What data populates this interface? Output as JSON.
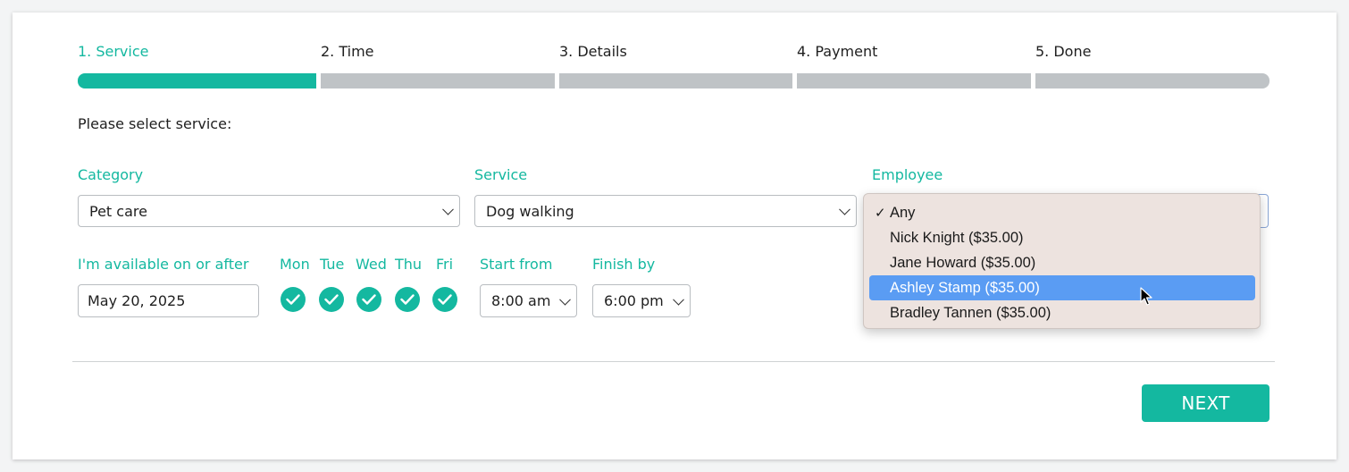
{
  "steps": [
    {
      "label": "1. Service",
      "active": true
    },
    {
      "label": "2. Time",
      "active": false
    },
    {
      "label": "3. Details",
      "active": false
    },
    {
      "label": "4. Payment",
      "active": false
    },
    {
      "label": "5. Done",
      "active": false
    }
  ],
  "prompt": "Please select service:",
  "category": {
    "label": "Category",
    "value": "Pet care"
  },
  "service": {
    "label": "Service",
    "value": "Dog walking"
  },
  "employee": {
    "label": "Employee",
    "options": [
      {
        "label": "Any",
        "checked": true,
        "highlighted": false
      },
      {
        "label": "Nick Knight ($35.00)",
        "checked": false,
        "highlighted": false
      },
      {
        "label": "Jane Howard ($35.00)",
        "checked": false,
        "highlighted": false
      },
      {
        "label": "Ashley Stamp ($35.00)",
        "checked": false,
        "highlighted": true
      },
      {
        "label": "Bradley Tannen ($35.00)",
        "checked": false,
        "highlighted": false
      }
    ]
  },
  "availability": {
    "label": "I'm available on or after",
    "value": "May 20, 2025"
  },
  "days": [
    "Mon",
    "Tue",
    "Wed",
    "Thu",
    "Fri"
  ],
  "start_from": {
    "label": "Start from",
    "value": "8:00 am"
  },
  "finish_by": {
    "label": "Finish by",
    "value": "6:00 pm"
  },
  "next_label": "NEXT",
  "colors": {
    "accent": "#14b8a0",
    "inactive_bar": "#bfc3c6",
    "highlight": "#5a9cf3"
  }
}
